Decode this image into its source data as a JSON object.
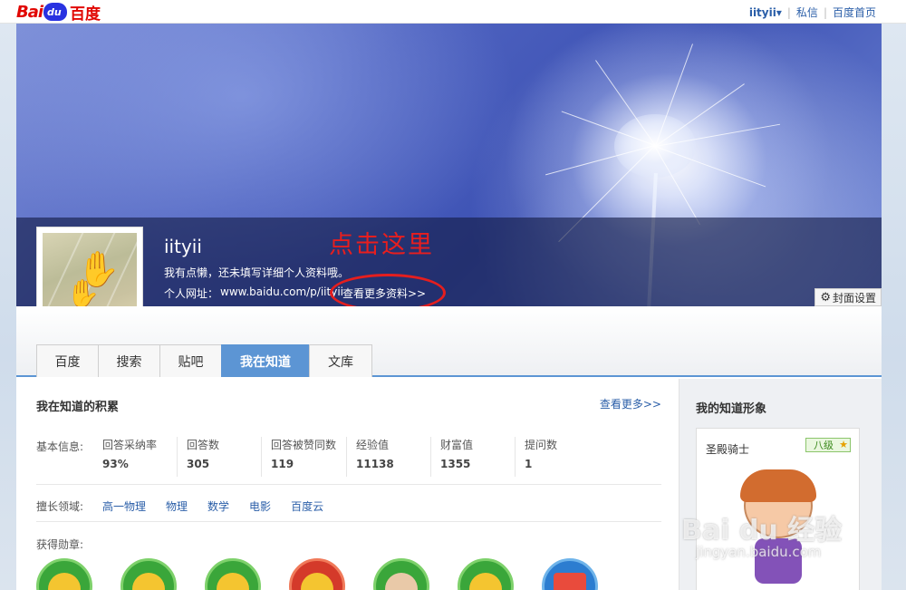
{
  "topbar": {
    "logo_text_1": "Bai",
    "logo_text_2": "du",
    "logo_text_3": "百度",
    "username": "iityii▾",
    "messages": "私信",
    "homepage": "百度首页"
  },
  "profile": {
    "username": "iityii",
    "intro": "我有点懒，还未填写详细个人资料哦。",
    "homepage_label": "个人网址：",
    "homepage_url": "www.baidu.com/p/iityii",
    "more_info": "查看更多资料>>",
    "annotation": "点击这里",
    "cover_settings": "封面设置"
  },
  "tabs": [
    {
      "label": "百度"
    },
    {
      "label": "搜索"
    },
    {
      "label": "贴吧"
    },
    {
      "label": "我在知道",
      "active": true
    },
    {
      "label": "文库"
    }
  ],
  "zhidao": {
    "title": "我在知道的积累",
    "view_more": "查看更多>>",
    "basic_label": "基本信息:",
    "stats": [
      {
        "label": "回答采纳率",
        "value": "93%"
      },
      {
        "label": "回答数",
        "value": "305"
      },
      {
        "label": "回答被赞同数",
        "value": "119"
      },
      {
        "label": "经验值",
        "value": "11138"
      },
      {
        "label": "财富值",
        "value": "1355"
      },
      {
        "label": "提问数",
        "value": "1"
      }
    ],
    "fields_label": "擅长领域:",
    "fields": [
      "高一物理",
      "物理",
      "数学",
      "电影",
      "百度云"
    ],
    "medals_label": "获得勋章:"
  },
  "image_panel": {
    "title": "我的知道形象",
    "character_name": "圣殿骑士",
    "level": "八级"
  },
  "watermark": {
    "main": "Bai du 经验",
    "sub": "jingyan.baidu.com"
  },
  "colors": {
    "link": "#2a5ea8",
    "tab_active": "#5c95d4",
    "annotation": "#e51e1e",
    "brand_red": "#e10602",
    "brand_blue": "#2932e1"
  }
}
